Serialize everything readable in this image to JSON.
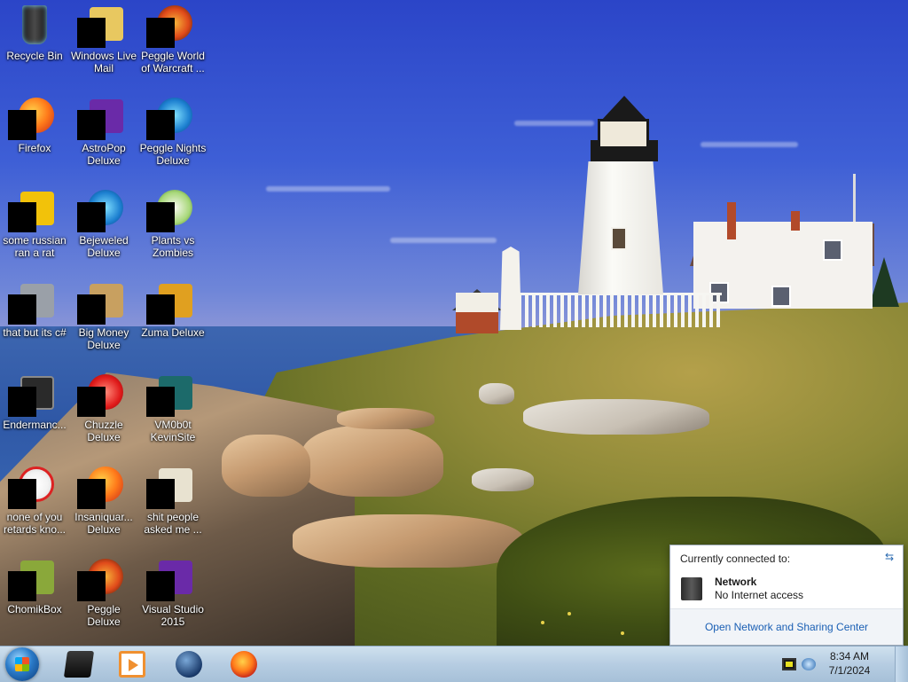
{
  "desktop": {
    "icons": [
      {
        "label": "Recycle Bin"
      },
      {
        "label": "Windows Live\nMail"
      },
      {
        "label": "Peggle World\nof Warcraft ..."
      },
      {
        "label": "Firefox"
      },
      {
        "label": "AstroPop\nDeluxe"
      },
      {
        "label": "Peggle Nights\nDeluxe"
      },
      {
        "label": "some russian\nran a rat"
      },
      {
        "label": "Bejeweled\nDeluxe"
      },
      {
        "label": "Plants vs\nZombies"
      },
      {
        "label": "that but its c#"
      },
      {
        "label": "Big Money\nDeluxe"
      },
      {
        "label": "Zuma Deluxe"
      },
      {
        "label": "Endermanc..."
      },
      {
        "label": "Chuzzle\nDeluxe"
      },
      {
        "label": "VM0b0t\nKevinSite"
      },
      {
        "label": "none of you\nretards kno..."
      },
      {
        "label": "Insaniquar...\nDeluxe"
      },
      {
        "label": "shit people\nasked me ..."
      },
      {
        "label": "ChomikBox"
      },
      {
        "label": "Peggle Deluxe"
      },
      {
        "label": "Visual Studio\n2015"
      }
    ]
  },
  "network_flyout": {
    "header": "Currently connected to:",
    "network_name": "Network",
    "network_status": "No Internet access",
    "link": "Open Network and Sharing Center"
  },
  "taskbar": {
    "pinned": [
      {
        "icon": "windows-explorer-icon"
      },
      {
        "icon": "media-player-icon"
      },
      {
        "icon": "globe-icon"
      },
      {
        "icon": "firefox-icon"
      }
    ],
    "clock": {
      "time": "8:34 AM",
      "date": "7/1/2024"
    }
  }
}
